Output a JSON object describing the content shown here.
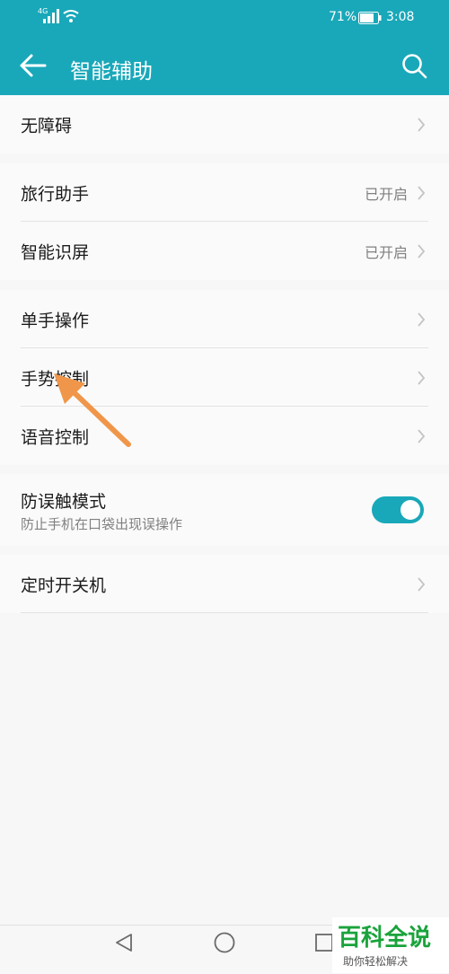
{
  "status_bar": {
    "network": "4G",
    "battery": "71%",
    "time": "3:08"
  },
  "header": {
    "title": "智能辅助"
  },
  "groups": {
    "accessibility": {
      "label": "无障碍"
    },
    "travel": {
      "label": "旅行助手",
      "value": "已开启"
    },
    "screen_recognition": {
      "label": "智能识屏",
      "value": "已开启"
    },
    "one_hand": {
      "label": "单手操作"
    },
    "gesture": {
      "label": "手势控制"
    },
    "voice": {
      "label": "语音控制"
    },
    "pocket_mode": {
      "label": "防误触模式",
      "sub": "防止手机在口袋出现误操作",
      "enabled": true
    },
    "schedule_power": {
      "label": "定时开关机"
    }
  },
  "colors": {
    "accent": "#19a8b9",
    "annotation_arrow": "#f0964a",
    "watermark_green": "#1aa33c"
  },
  "watermark": {
    "title": "百科全说",
    "subtitle": "助你轻松解决"
  }
}
